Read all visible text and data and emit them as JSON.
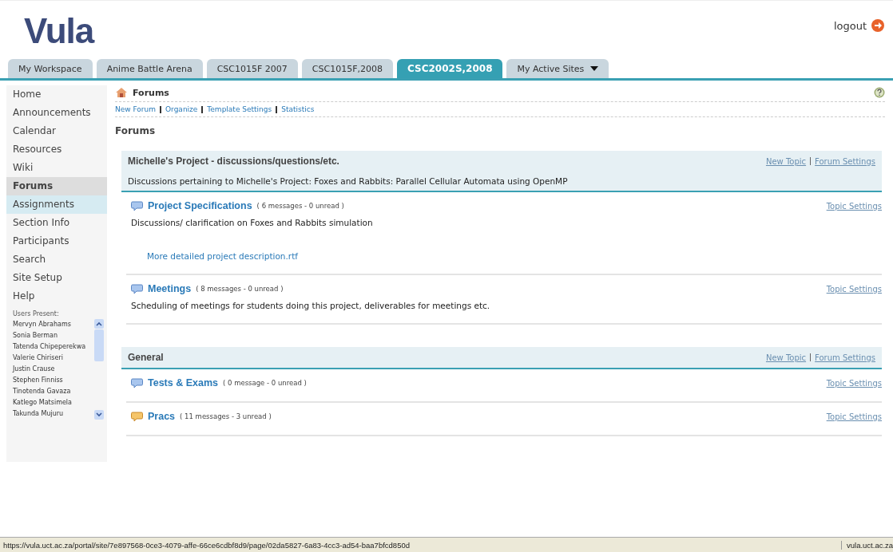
{
  "logo": "Vula",
  "logout": "logout",
  "tabs": [
    {
      "label": "My Workspace",
      "selected": false
    },
    {
      "label": "Anime Battle Arena",
      "selected": false
    },
    {
      "label": "CSC1015F 2007",
      "selected": false
    },
    {
      "label": "CSC1015F,2008",
      "selected": false
    },
    {
      "label": "CSC2002S,2008",
      "selected": true
    },
    {
      "label": "My Active Sites",
      "selected": false,
      "kind": "dropdown"
    }
  ],
  "sidebar": {
    "items": [
      {
        "label": "Home",
        "selected": false,
        "highlighted": false
      },
      {
        "label": "Announcements",
        "selected": false,
        "highlighted": false
      },
      {
        "label": "Calendar",
        "selected": false,
        "highlighted": false
      },
      {
        "label": "Resources",
        "selected": false,
        "highlighted": false
      },
      {
        "label": "Wiki",
        "selected": false,
        "highlighted": false
      },
      {
        "label": "Forums",
        "selected": true,
        "highlighted": false
      },
      {
        "label": "Assignments",
        "selected": false,
        "highlighted": true
      },
      {
        "label": "Section Info",
        "selected": false,
        "highlighted": false
      },
      {
        "label": "Participants",
        "selected": false,
        "highlighted": false
      },
      {
        "label": "Search",
        "selected": false,
        "highlighted": false
      },
      {
        "label": "Site Setup",
        "selected": false,
        "highlighted": false
      },
      {
        "label": "Help",
        "selected": false,
        "highlighted": false
      }
    ],
    "users_present": {
      "heading": "Users Present:",
      "users": [
        "Mervyn Abrahams",
        "Sonia Berman",
        "Tatenda Chipeperekwa",
        "Valerie Chiriseri",
        "Justin Crause",
        "Stephen Finniss",
        "Tinotenda Gavaza",
        "Katlego Matsimela",
        "Takunda Mujuru"
      ]
    }
  },
  "tool": {
    "title": "Forums",
    "actions": [
      "New Forum",
      "Organize",
      "Template Settings",
      "Statistics"
    ],
    "heading": "Forums"
  },
  "forums": [
    {
      "title": "Michelle's Project - discussions/questions/etc.",
      "description": "Discussions pertaining to Michelle's Project: Foxes and Rabbits: Parallel Cellular Automata using OpenMP",
      "links": [
        "New Topic",
        "Forum Settings"
      ],
      "topics": [
        {
          "title": "Project Specifications",
          "counts": "( 6 messages - 0 unread )",
          "has_unread": false,
          "settings": "Topic Settings",
          "description": "Discussions/ clarification on Foxes and Rabbits simulation",
          "attachment": "More detailed project description.rtf"
        },
        {
          "title": "Meetings",
          "counts": "( 8 messages - 0 unread )",
          "has_unread": false,
          "settings": "Topic Settings",
          "description": "Scheduling of meetings for students doing this project, deliverables for meetings etc."
        }
      ]
    },
    {
      "title": "General",
      "links": [
        "New Topic",
        "Forum Settings"
      ],
      "topics": [
        {
          "title": "Tests & Exams",
          "counts": "( 0 message - 0 unread )",
          "has_unread": false,
          "settings": "Topic Settings"
        },
        {
          "title": "Pracs",
          "counts": "( 11 messages - 3 unread )",
          "has_unread": true,
          "settings": "Topic Settings"
        }
      ]
    }
  ],
  "status_bar": {
    "url": "https://vula.uct.ac.za/portal/site/7e897568-0ce3-4079-affe-66ce6cdbf8d9/page/02da5827-6a83-4cc3-ad54-baa7bfcd850d",
    "zone": "vula.uct.ac.za"
  }
}
